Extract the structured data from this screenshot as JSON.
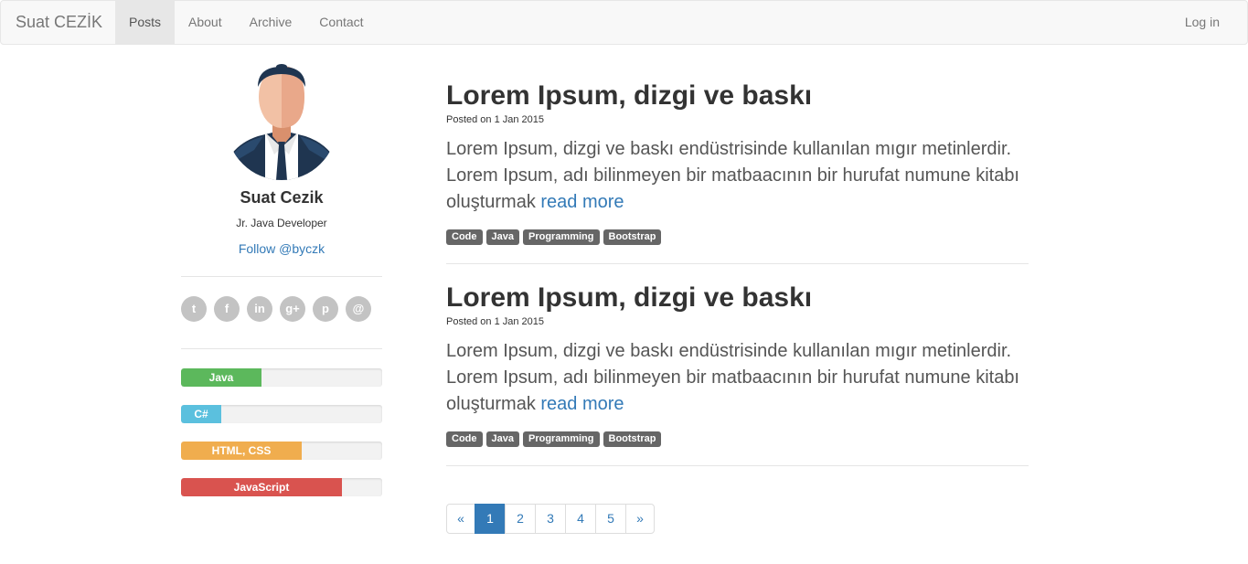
{
  "navbar": {
    "brand": "Suat CEZİK",
    "items": [
      {
        "label": "Posts",
        "active": true
      },
      {
        "label": "About",
        "active": false
      },
      {
        "label": "Archive",
        "active": false
      },
      {
        "label": "Contact",
        "active": false
      }
    ],
    "login": "Log in"
  },
  "profile": {
    "name": "Suat Cezik",
    "role": "Jr. Java Developer",
    "follow": "Follow @byczk"
  },
  "socials": [
    {
      "icon": "twitter-icon",
      "glyph": "t"
    },
    {
      "icon": "facebook-icon",
      "glyph": "f"
    },
    {
      "icon": "linkedin-icon",
      "glyph": "in"
    },
    {
      "icon": "googleplus-icon",
      "glyph": "g+"
    },
    {
      "icon": "pinterest-icon",
      "glyph": "p"
    },
    {
      "icon": "email-icon",
      "glyph": "@"
    }
  ],
  "skills": [
    {
      "label": "Java",
      "percent": 40,
      "color": "#5cb85c"
    },
    {
      "label": "C#",
      "percent": 20,
      "color": "#5bc0de"
    },
    {
      "label": "HTML, CSS",
      "percent": 60,
      "color": "#f0ad4e"
    },
    {
      "label": "JavaScript",
      "percent": 80,
      "color": "#d9534f"
    }
  ],
  "posts": [
    {
      "title": "Lorem Ipsum, dizgi ve baskı",
      "meta": "Posted on 1 Jan 2015",
      "body": "Lorem Ipsum, dizgi ve baskı endüstrisinde kullanılan mıgır metinlerdir. Lorem Ipsum, adı bilinmeyen bir matbaacının bir hurufat numune kitabı oluşturmak ",
      "read_more": "read more",
      "tags": [
        "Code",
        "Java",
        "Programming",
        "Bootstrap"
      ]
    },
    {
      "title": "Lorem Ipsum, dizgi ve baskı",
      "meta": "Posted on 1 Jan 2015",
      "body": "Lorem Ipsum, dizgi ve baskı endüstrisinde kullanılan mıgır metinlerdir. Lorem Ipsum, adı bilinmeyen bir matbaacının bir hurufat numune kitabı oluşturmak ",
      "read_more": "read more",
      "tags": [
        "Code",
        "Java",
        "Programming",
        "Bootstrap"
      ]
    }
  ],
  "pagination": {
    "prev": "«",
    "pages": [
      "1",
      "2",
      "3",
      "4",
      "5"
    ],
    "active": "1",
    "next": "»"
  }
}
